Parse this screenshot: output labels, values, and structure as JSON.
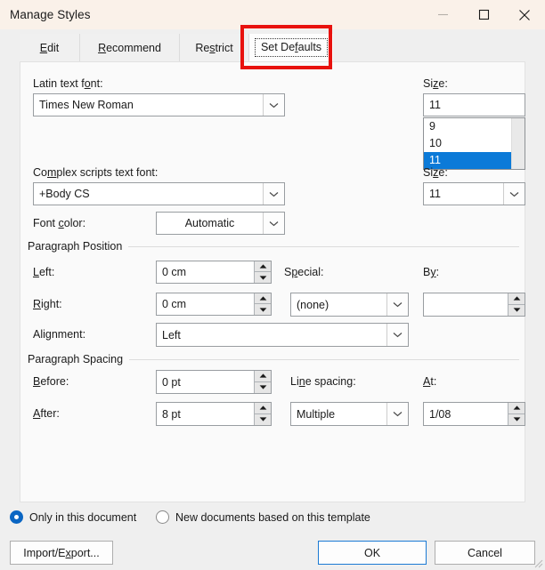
{
  "window": {
    "title": "Manage Styles",
    "controls": [
      {
        "name": "minimize",
        "glyph": "minimize-icon"
      },
      {
        "name": "maximize",
        "glyph": "maximize-icon"
      },
      {
        "name": "close",
        "glyph": "close-icon"
      }
    ]
  },
  "tabs": [
    {
      "label": "Edit",
      "accel": "E",
      "selected": false
    },
    {
      "label": "Recommend",
      "accel": "R",
      "selected": false
    },
    {
      "label": "Restrict",
      "accel": "s",
      "selected": false
    },
    {
      "label": "Set Defaults",
      "accel": "f",
      "selected": true
    }
  ],
  "annotation": {
    "color": "#e8120e",
    "targets": "Set Defaults"
  },
  "form": {
    "latin_font": {
      "label_pre": "Latin text f",
      "label_accel": "o",
      "label_post": "nt:",
      "value": "Times New Roman"
    },
    "latin_size": {
      "label_pre": "Si",
      "label_accel": "z",
      "label_post": "e:",
      "value": "11",
      "options": [
        "9",
        "10",
        "11"
      ],
      "selected_option": "11",
      "selection_color": "#0b7ad8"
    },
    "complex_font": {
      "label_pre": "Co",
      "label_accel": "m",
      "label_post": "plex scripts text font:",
      "value": "+Body CS"
    },
    "complex_size": {
      "label_pre": "Si",
      "label_accel": "z",
      "label_post": "e:",
      "value": "11"
    },
    "font_color": {
      "label_pre": "Font ",
      "label_accel": "c",
      "label_post": "olor:",
      "value": "Automatic"
    }
  },
  "paragraph_position": {
    "group_label": "Paragraph Position",
    "left": {
      "label_accel": "L",
      "label_post": "eft:",
      "value": "0 cm"
    },
    "right": {
      "label_accel": "R",
      "label_post": "ight:",
      "value": "0 cm"
    },
    "alignment": {
      "label_pre": "Ali",
      "label_accel": "g",
      "label_post": "nment:",
      "value": "Left"
    },
    "special": {
      "label_pre": "S",
      "label_accel": "p",
      "label_post": "ecial:",
      "value": "(none)"
    },
    "by": {
      "label_pre": "B",
      "label_accel": "y",
      "label_post": ":",
      "value": ""
    }
  },
  "paragraph_spacing": {
    "group_label": "Paragraph Spacing",
    "before": {
      "label_pre": "",
      "label_accel": "B",
      "label_post": "efore:",
      "value": "0 pt"
    },
    "after": {
      "label_pre": "",
      "label_accel": "A",
      "label_post": "fter:",
      "value": "8 pt"
    },
    "line_spacing": {
      "label_pre": "Li",
      "label_accel": "n",
      "label_post": "e spacing:",
      "value": "Multiple"
    },
    "at": {
      "label_pre": "",
      "label_accel": "A",
      "label_post": "t:",
      "value": "1/08"
    }
  },
  "scope": {
    "options": [
      {
        "label": "Only in this document",
        "selected": true
      },
      {
        "label": "New documents based on this template",
        "selected": false
      }
    ],
    "accent": "#0b66c3"
  },
  "buttons": {
    "import_export_pre": "Import/E",
    "import_export_accel": "x",
    "import_export_post": "port...",
    "ok": "OK",
    "cancel": "Cancel"
  }
}
